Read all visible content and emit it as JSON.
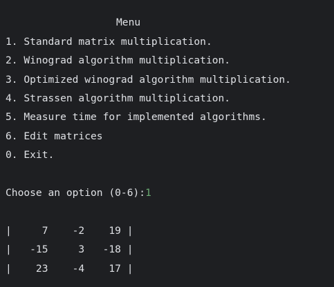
{
  "menu": {
    "title": "Menu",
    "items": [
      "1. Standard matrix multiplication.",
      "2. Winograd algorithm multiplication.",
      "3. Optimized winograd algorithm multiplication.",
      "4. Strassen algorithm multiplication.",
      "5. Measure time for implemented algorithms.",
      "6. Edit matrices",
      "0. Exit."
    ]
  },
  "prompt": {
    "text": "Choose an option (0-6):",
    "input": "1"
  },
  "matrix": {
    "rows": [
      "|     7    -2    19 |",
      "|   -15     3   -18 |",
      "|    23    -4    17 |"
    ]
  },
  "colors": {
    "background": "#1e1f22",
    "text": "#dfe1e5",
    "user_input": "#6aab73"
  }
}
